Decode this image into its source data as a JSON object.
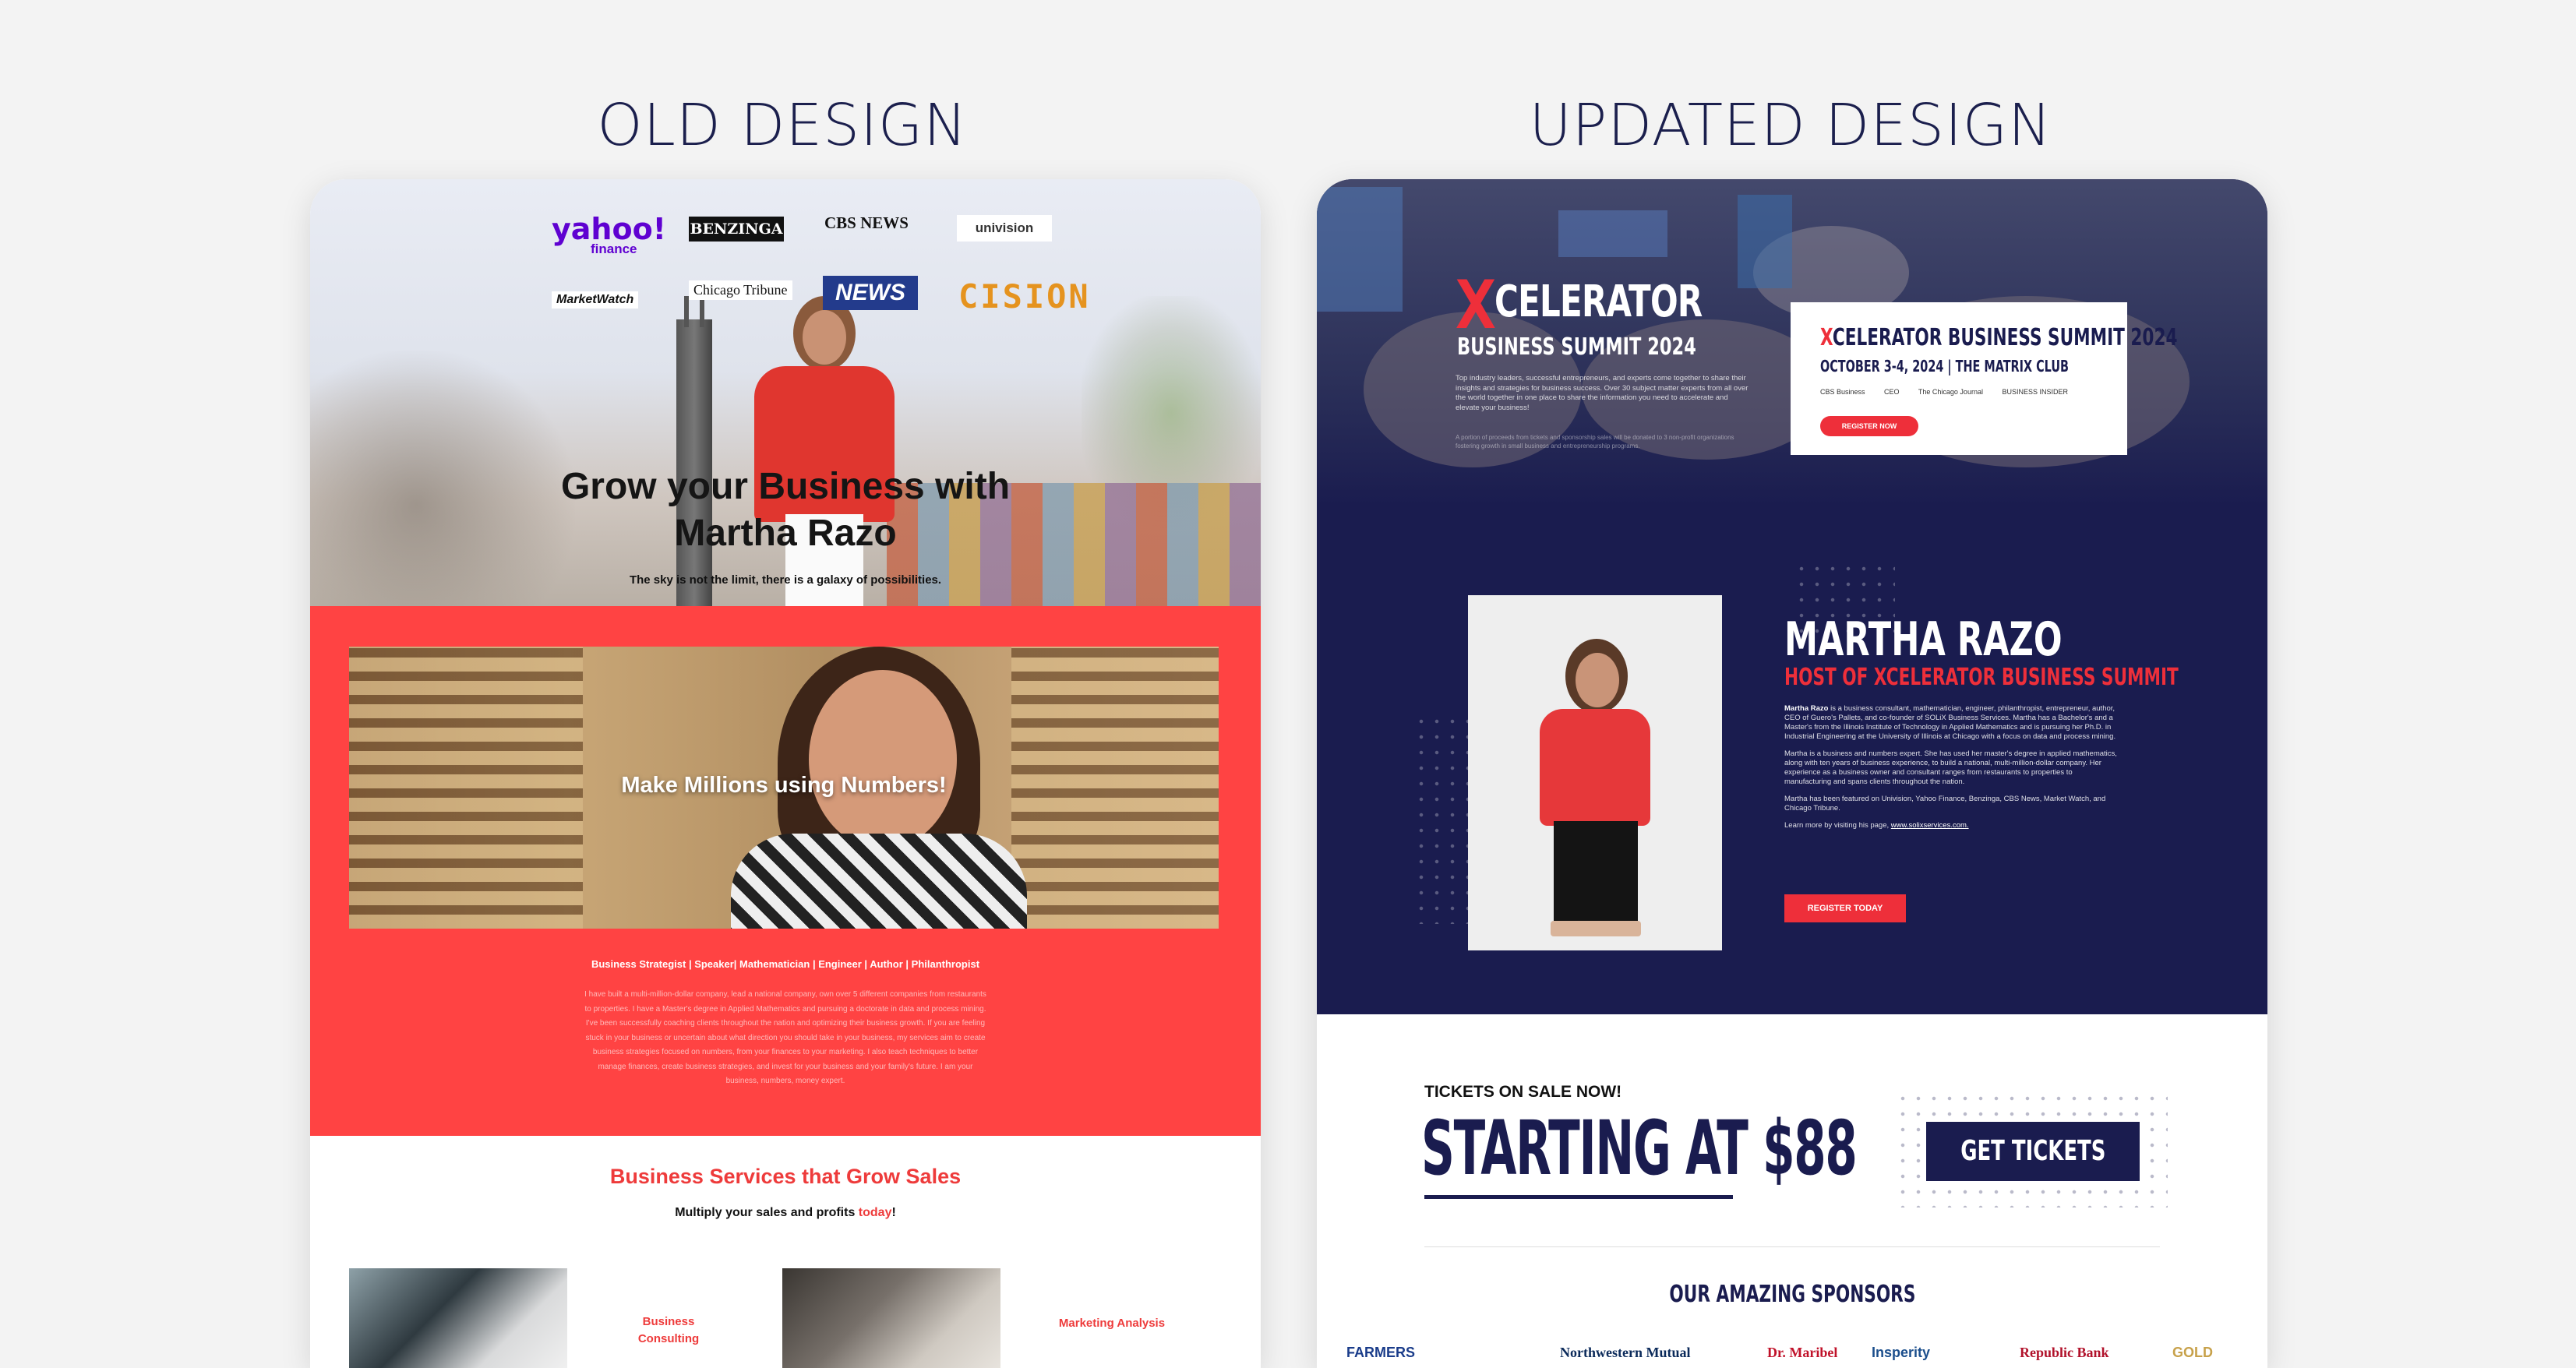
{
  "old_heading": "OLD DESIGN",
  "new_heading": "UPDATED DESIGN",
  "old": {
    "logos": [
      "yahoo!",
      "finance",
      "BENZINGA",
      "CBS NEWS",
      "univision",
      "MarketWatch",
      "Chicago Tribune",
      "NEWS",
      "CISION"
    ],
    "hero_title_1": "Grow your Business with",
    "hero_title_2": "Martha Razo",
    "hero_sub": "The sky is not the limit, there is a galaxy of possibilities.",
    "video_text": "Make Millions using Numbers!",
    "roles": "Business Strategist | Speaker| Mathematician | Engineer | Author | Philanthropist",
    "para": "I have built a multi-million-dollar company, lead a national company, own over 5 different companies from restaurants to properties. I have a Master's degree in Applied Mathematics and pursuing a doctorate in data and process mining. I've been successfully coaching clients throughout the nation and optimizing their business growth. If you are feeling stuck in your business or uncertain about what direction you should take in your business, my services aim to create business strategies focused on numbers, from your finances to your marketing. I also teach techniques to better manage finances, create business strategies, and invest for your business and your family's future. I am your business, numbers, money expert.",
    "services_title": "Business Services that Grow Sales",
    "services_sub_1": "Multiply your sales and profits ",
    "services_sub_red": "today",
    "services_sub_end": "!",
    "service_1": "Business Consulting",
    "service_2": "Marketing Analysis"
  },
  "new": {
    "logo_x": "X",
    "logo_text": "CELERATOR",
    "logo_sub": "BUSINESS SUMMIT 2024",
    "hero_para": "Top industry leaders, successful entrepreneurs, and experts come together to share their insights and strategies for business success. Over 30 subject matter experts from all over the world together in one place to share the information you need to accelerate and elevate your business!",
    "hero_fine": "A portion of proceeds from tickets and sponsorship sales will be donated to 3 non-profit organizations fostering growth in small business and entrepreneurship programs.",
    "card_title_x": "X",
    "card_title": "CELERATOR BUSINESS SUMMIT 2024",
    "card_date": "OCTOBER 3-4, 2024 | THE MATRIX CLUB",
    "card_logos": [
      "CBS Business",
      "CEO",
      "The Chicago Journal",
      "BUSINESS INSIDER"
    ],
    "card_button": "REGISTER NOW",
    "name": "MARTHA RAZO",
    "host": "HOST OF XCELERATOR BUSINESS SUMMIT",
    "bio_name": "Martha Razo",
    "bio_1": " is a business consultant, mathematician, engineer, philanthropist, entrepreneur, author, CEO of Guero's Pallets, and co-founder of SOLiX Business Services. Martha has a Bachelor's and a Master's from the Illinois Institute of Technology in Applied Mathematics and is pursuing her Ph.D. in Industrial Engineering at the University of Illinois at Chicago with a focus on data and process mining.",
    "bio_2": "Martha is a business and numbers expert. She has used her master's degree in applied mathematics, along with ten years of business experience, to build a national, multi-million-dollar company. Her experience as a business owner and consultant ranges from restaurants to properties to manufacturing and spans clients throughout the nation.",
    "bio_3": "Martha has been featured on Univision, Yahoo Finance, Benzinga, CBS News, Market Watch, and Chicago Tribune.",
    "bio_4": "Learn more by visiting his page, ",
    "bio_link": "www.solixservices.com.",
    "register_button": "REGISTER TODAY",
    "tickets_small": "TICKETS ON SALE NOW!",
    "tickets_big": "STARTING AT $88",
    "get_tickets": "GET TICKETS",
    "sponsors_title": "OUR AMAZING SPONSORS",
    "sponsors": [
      "FARMERS",
      "Northwestern Mutual",
      "Dr. Maribel",
      "Insperity",
      "Republic Bank",
      "GOLD"
    ]
  },
  "colors": {
    "page_bg": "#f3f3f3",
    "navy": "#1a1c4f",
    "red_old": "#ff4343",
    "red_new": "#ee2f3a"
  }
}
